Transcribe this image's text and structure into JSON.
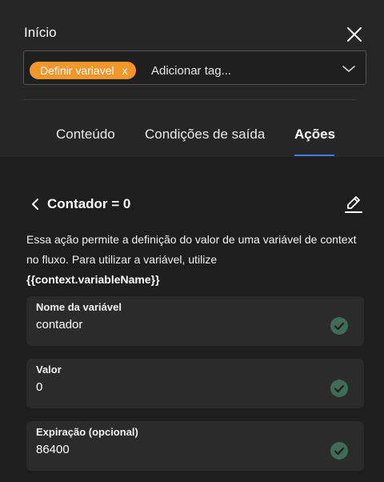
{
  "header": {
    "title": "Início",
    "close_icon": "close-icon"
  },
  "tags": {
    "chips": [
      {
        "label": "Definir variavel",
        "remove": "x"
      }
    ],
    "placeholder": "Adicionar tag...",
    "chevron_icon": "chevron-down-icon",
    "chip_color": "#f5962b"
  },
  "tabs": [
    {
      "label": "Conteúdo",
      "active": false
    },
    {
      "label": "Condições de saída",
      "active": false
    },
    {
      "label": "Ações",
      "active": true
    }
  ],
  "accent_color": "#3c7bf2",
  "action": {
    "title": "Contador = 0",
    "back_icon": "chevron-left-icon",
    "edit_icon": "pencil-icon",
    "description": "Essa ação permite a definição do valor de uma variável de context no fluxo. Para utilizar a variável, utilize",
    "code": "{{context.variableName}}"
  },
  "fields": [
    {
      "label": "Nome da variável",
      "value": "contador",
      "valid": true
    },
    {
      "label": "Valor",
      "value": "0",
      "valid": true
    },
    {
      "label": "Expiração (opcional)",
      "value": "86400",
      "valid": true
    }
  ],
  "valid_color": "#3f6b58"
}
